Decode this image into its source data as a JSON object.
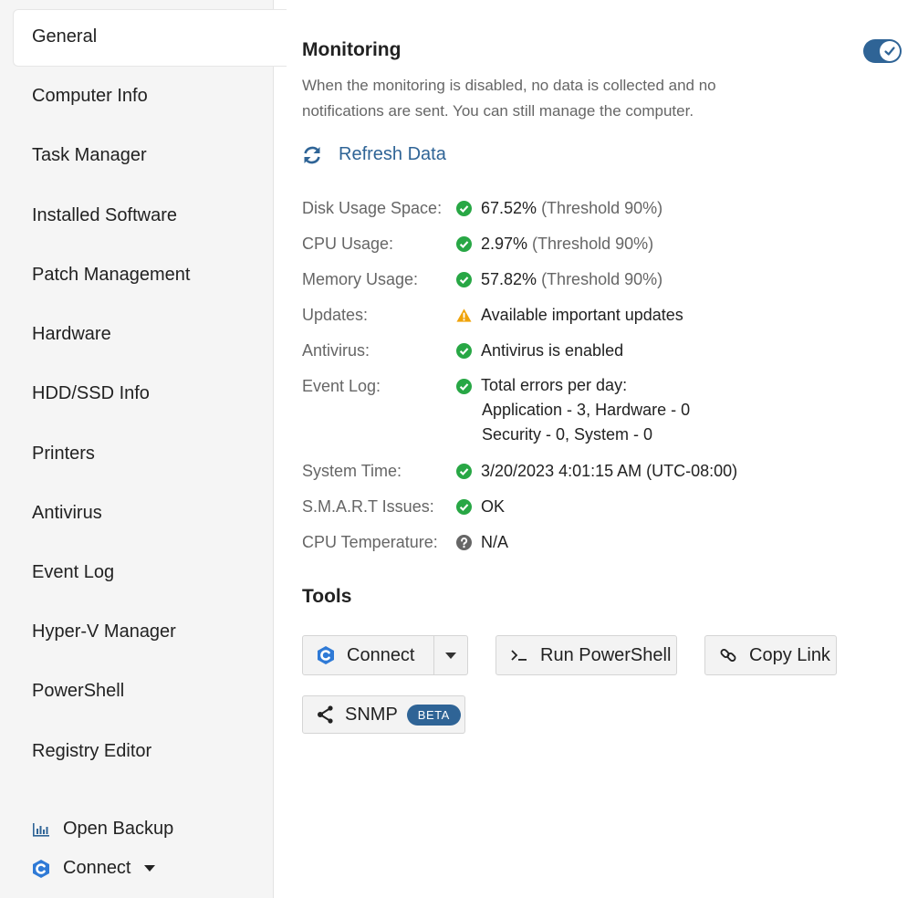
{
  "sidebar": {
    "items": [
      {
        "label": "General",
        "active": true
      },
      {
        "label": "Computer Info"
      },
      {
        "label": "Task Manager"
      },
      {
        "label": "Installed Software"
      },
      {
        "label": "Patch Management"
      },
      {
        "label": "Hardware"
      },
      {
        "label": "HDD/SSD Info"
      },
      {
        "label": "Printers"
      },
      {
        "label": "Antivirus"
      },
      {
        "label": "Event Log"
      },
      {
        "label": "Hyper-V Manager"
      },
      {
        "label": "PowerShell"
      },
      {
        "label": "Registry Editor"
      }
    ],
    "footer": {
      "open_backup": "Open Backup",
      "connect": "Connect"
    }
  },
  "monitoring": {
    "title": "Monitoring",
    "enabled": true,
    "description": "When the monitoring is disabled, no data is collected and no notifications are sent. You can still manage the computer.",
    "refresh_label": "Refresh Data"
  },
  "status": [
    {
      "label": "Disk Usage Space:",
      "value": "67.52%",
      "threshold": "(Threshold 90%)",
      "icon": "check-circle-icon"
    },
    {
      "label": "CPU Usage:",
      "value": "2.97%",
      "threshold": "(Threshold 90%)",
      "icon": "check-circle-icon"
    },
    {
      "label": "Memory Usage:",
      "value": "57.82%",
      "threshold": "(Threshold 90%)",
      "icon": "check-circle-icon"
    },
    {
      "label": "Updates:",
      "value": "Available important updates",
      "icon": "warning-icon"
    },
    {
      "label": "Antivirus:",
      "value": "Antivirus is enabled",
      "icon": "check-circle-icon"
    },
    {
      "label": "Event Log:",
      "value": "Total errors per day:",
      "line2": "Application - 3, Hardware - 0",
      "line3": "Security - 0, System - 0",
      "icon": "check-circle-icon"
    },
    {
      "label": "System Time:",
      "value": "3/20/2023 4:01:15 AM (UTC-08:00)",
      "icon": "check-circle-icon"
    },
    {
      "label": "S.M.A.R.T Issues:",
      "value": "OK",
      "icon": "check-circle-icon"
    },
    {
      "label": "CPU Temperature:",
      "value": "N/A",
      "icon": "question-circle-icon"
    }
  ],
  "tools": {
    "title": "Tools",
    "connect": "Connect",
    "run_powershell": "Run PowerShell",
    "copy_link": "Copy Link",
    "snmp": "SNMP",
    "beta": "BETA"
  },
  "colors": {
    "accent": "#2f6496",
    "ok": "#28a745",
    "warning": "#f0a30a",
    "unknown": "#666666"
  }
}
